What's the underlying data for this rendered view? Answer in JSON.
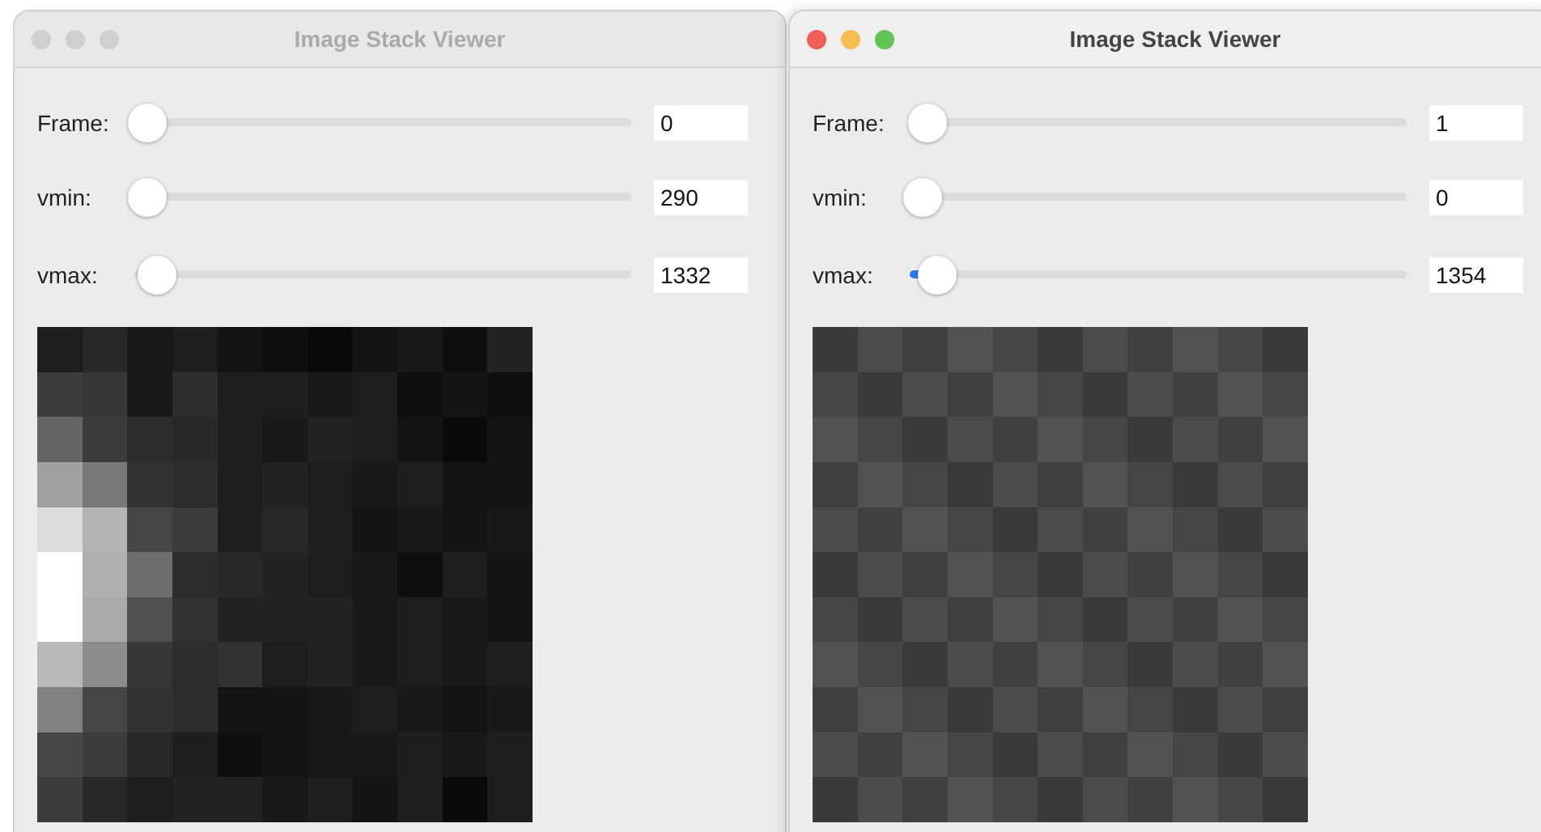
{
  "windows": [
    {
      "title": "Image Stack Viewer",
      "active": false,
      "sliders": [
        {
          "label": "Frame:",
          "level": 0.0,
          "value": "0"
        },
        {
          "label": "vmin:",
          "level": 0.0,
          "value": "290"
        },
        {
          "label": "vmax:",
          "level": 0.02,
          "value": "1332"
        }
      ]
    },
    {
      "title": "Image Stack Viewer",
      "active": true,
      "sliders": [
        {
          "label": "Frame:",
          "level": 0.01,
          "value": "1"
        },
        {
          "label": "vmin:",
          "level": 0.0,
          "value": "0"
        },
        {
          "label": "vmax:",
          "level": 0.03,
          "value": "1354"
        }
      ]
    }
  ]
}
